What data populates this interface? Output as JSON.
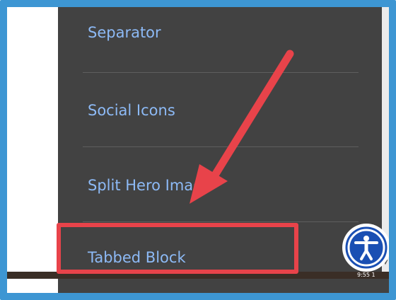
{
  "menu": {
    "items": [
      {
        "label": "Separator"
      },
      {
        "label": "Social Icons"
      },
      {
        "label": "Split Hero Image"
      },
      {
        "label": "Tabbed Block"
      }
    ]
  },
  "annotation": {
    "arrow_color": "#e8434a",
    "highlight_color": "#e8434a",
    "frame_color": "#3d96d3"
  },
  "accessibility_button": {
    "icon": "accessibility-icon",
    "color": "#1a4fb3"
  },
  "status": {
    "bottom_text": "9:55 1"
  }
}
